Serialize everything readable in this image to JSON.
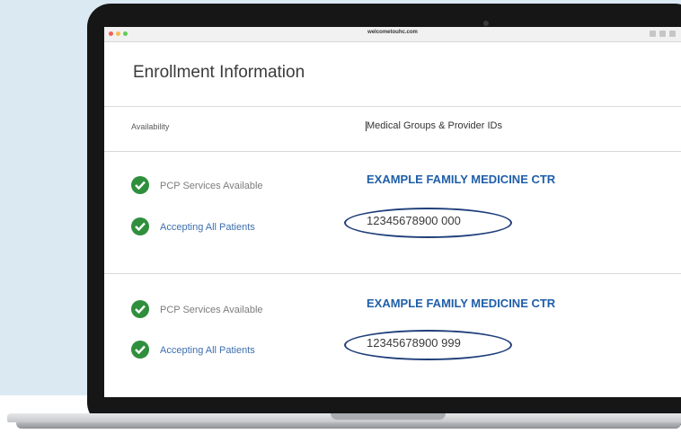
{
  "browser": {
    "url": "welcometouhc.com"
  },
  "page": {
    "title": "Enrollment Information"
  },
  "table": {
    "headers": {
      "availability": "Availability",
      "groups": "Medical Groups & Provider IDs"
    },
    "rows": [
      {
        "service": "PCP Services Available",
        "patients": "Accepting All Patients",
        "provider": "EXAMPLE FAMILY MEDICINE CTR",
        "provider_id": "12345678900 000"
      },
      {
        "service": "PCP Services Available",
        "patients": "Accepting All Patients",
        "provider": "EXAMPLE FAMILY MEDICINE CTR",
        "provider_id": "12345678900 999"
      }
    ]
  },
  "colors": {
    "check_green": "#2f8f3d",
    "provider_blue": "#1f5fa8",
    "oval_navy": "#1f3f7a"
  }
}
